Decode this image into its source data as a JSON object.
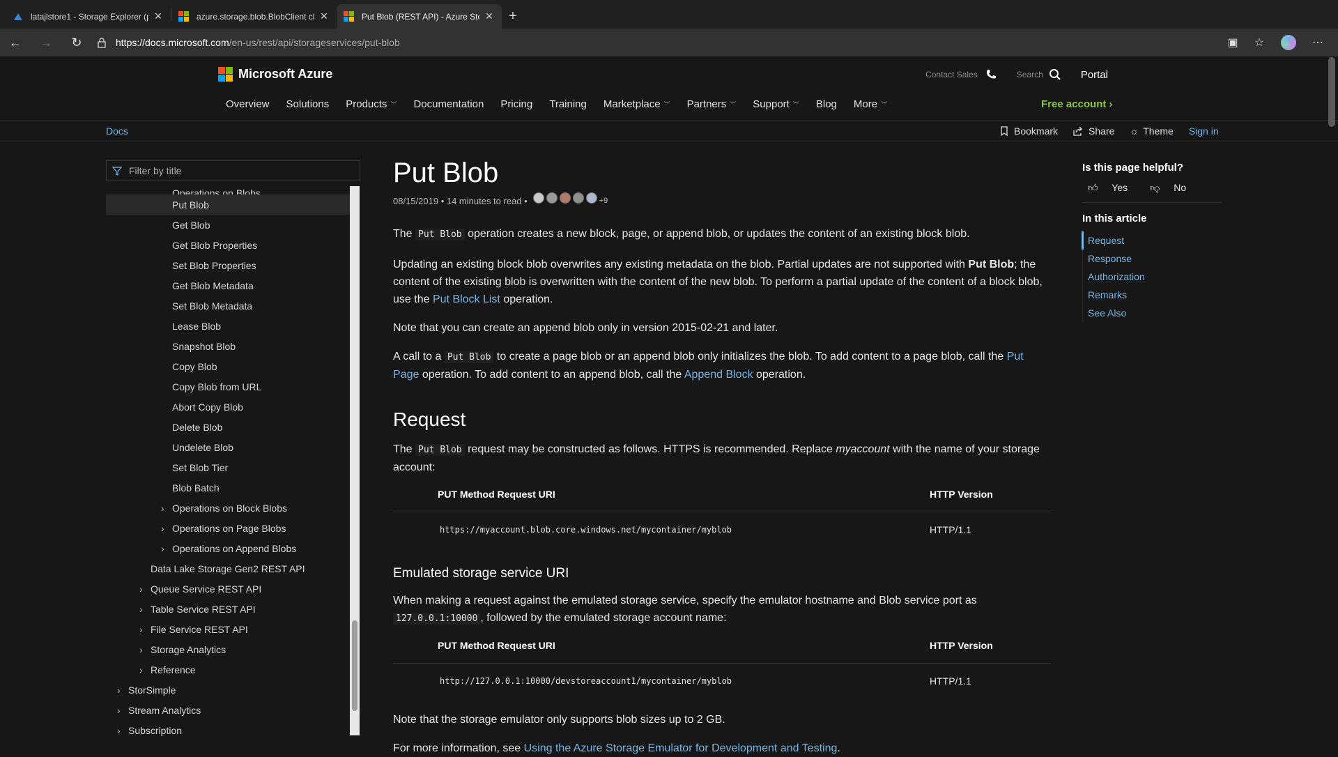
{
  "browser": {
    "tabs": [
      {
        "title": "latajlstore1 - Storage Explorer (p",
        "active": false
      },
      {
        "title": "azure.storage.blob.BlobClient cl",
        "active": false
      },
      {
        "title": "Put Blob (REST API) - Azure Sto",
        "active": true
      }
    ],
    "new_tab": "+",
    "url_host": "https://docs.microsoft.com",
    "url_path": "/en-us/rest/api/storageservices/put-blob"
  },
  "header": {
    "brand": "Microsoft Azure",
    "contact_sales": "Contact Sales",
    "search": "Search",
    "portal": "Portal",
    "nav": [
      {
        "label": "Overview",
        "dropdown": false
      },
      {
        "label": "Solutions",
        "dropdown": false
      },
      {
        "label": "Products",
        "dropdown": true
      },
      {
        "label": "Documentation",
        "dropdown": false
      },
      {
        "label": "Pricing",
        "dropdown": false
      },
      {
        "label": "Training",
        "dropdown": false
      },
      {
        "label": "Marketplace",
        "dropdown": true
      },
      {
        "label": "Partners",
        "dropdown": true
      },
      {
        "label": "Support",
        "dropdown": true
      },
      {
        "label": "Blog",
        "dropdown": false
      },
      {
        "label": "More",
        "dropdown": true
      }
    ],
    "free_account": "Free account"
  },
  "docsbar": {
    "docs": "Docs",
    "bookmark": "Bookmark",
    "share": "Share",
    "theme": "Theme",
    "signin": "Sign in"
  },
  "sidebar": {
    "filter_placeholder": "Filter by title",
    "items": [
      {
        "label": "Operations on Blobs",
        "indent": 2,
        "caret": false,
        "selected": false
      },
      {
        "label": "Put Blob",
        "indent": 2,
        "caret": false,
        "selected": true
      },
      {
        "label": "Get Blob",
        "indent": 2,
        "caret": false,
        "selected": false
      },
      {
        "label": "Get Blob Properties",
        "indent": 2,
        "caret": false,
        "selected": false
      },
      {
        "label": "Set Blob Properties",
        "indent": 2,
        "caret": false,
        "selected": false
      },
      {
        "label": "Get Blob Metadata",
        "indent": 2,
        "caret": false,
        "selected": false
      },
      {
        "label": "Set Blob Metadata",
        "indent": 2,
        "caret": false,
        "selected": false
      },
      {
        "label": "Lease Blob",
        "indent": 2,
        "caret": false,
        "selected": false
      },
      {
        "label": "Snapshot Blob",
        "indent": 2,
        "caret": false,
        "selected": false
      },
      {
        "label": "Copy Blob",
        "indent": 2,
        "caret": false,
        "selected": false
      },
      {
        "label": "Copy Blob from URL",
        "indent": 2,
        "caret": false,
        "selected": false
      },
      {
        "label": "Abort Copy Blob",
        "indent": 2,
        "caret": false,
        "selected": false
      },
      {
        "label": "Delete Blob",
        "indent": 2,
        "caret": false,
        "selected": false
      },
      {
        "label": "Undelete Blob",
        "indent": 2,
        "caret": false,
        "selected": false
      },
      {
        "label": "Set Blob Tier",
        "indent": 2,
        "caret": false,
        "selected": false
      },
      {
        "label": "Blob Batch",
        "indent": 2,
        "caret": false,
        "selected": false
      },
      {
        "label": "Operations on Block Blobs",
        "indent": 2,
        "caret": true,
        "selected": false
      },
      {
        "label": "Operations on Page Blobs",
        "indent": 2,
        "caret": true,
        "selected": false
      },
      {
        "label": "Operations on Append Blobs",
        "indent": 2,
        "caret": true,
        "selected": false
      },
      {
        "label": "Data Lake Storage Gen2 REST API",
        "indent": 1,
        "caret": false,
        "selected": false
      },
      {
        "label": "Queue Service REST API",
        "indent": 1,
        "caret": true,
        "selected": false
      },
      {
        "label": "Table Service REST API",
        "indent": 1,
        "caret": true,
        "selected": false
      },
      {
        "label": "File Service REST API",
        "indent": 1,
        "caret": true,
        "selected": false
      },
      {
        "label": "Storage Analytics",
        "indent": 1,
        "caret": true,
        "selected": false
      },
      {
        "label": "Reference",
        "indent": 1,
        "caret": true,
        "selected": false
      },
      {
        "label": "StorSimple",
        "indent": 0,
        "caret": true,
        "selected": false
      },
      {
        "label": "Stream Analytics",
        "indent": 0,
        "caret": true,
        "selected": false
      },
      {
        "label": "Subscription",
        "indent": 0,
        "caret": true,
        "selected": false
      }
    ]
  },
  "article": {
    "title": "Put Blob",
    "date": "08/15/2019",
    "read_time": "14 minutes to read",
    "contributors_more": "+9",
    "p1_a": "The ",
    "p1_code": "Put Blob",
    "p1_b": " operation creates a new block, page, or append blob, or updates the content of an existing block blob.",
    "p2_a": "Updating an existing block blob overwrites any existing metadata on the blob. Partial updates are not supported with ",
    "p2_bold": "Put Blob",
    "p2_b": "; the content of the existing blob is overwritten with the content of the new blob. To perform a partial update of the content of a block blob, use the ",
    "p2_link": "Put Block List",
    "p2_c": " operation.",
    "p3": "Note that you can create an append blob only in version 2015-02-21 and later.",
    "p4_a": "A call to a ",
    "p4_code": "Put Blob",
    "p4_b": " to create a page blob or an append blob only initializes the blob. To add content to a page blob, call the ",
    "p4_link1": "Put Page",
    "p4_c": " operation. To add content to an append blob, call the ",
    "p4_link2": "Append Block",
    "p4_d": " operation.",
    "request_heading": "Request",
    "req_a": "The ",
    "req_code": "Put Blob",
    "req_b": " request may be constructed as follows. HTTPS is recommended. Replace ",
    "req_em": "myaccount",
    "req_c": " with the name of your storage account:",
    "table1": {
      "col_uri": "PUT Method Request URI",
      "col_ver": "HTTP Version",
      "uri": "https://myaccount.blob.core.windows.net/mycontainer/myblob",
      "ver": "HTTP/1.1"
    },
    "emulated_heading": "Emulated storage service URI",
    "emu_a": "When making a request against the emulated storage service, specify the emulator hostname and Blob service port as ",
    "emu_code": "127.0.0.1:10000",
    "emu_b": ", followed by the emulated storage account name:",
    "table2": {
      "col_uri": "PUT Method Request URI",
      "col_ver": "HTTP Version",
      "uri": "http://127.0.0.1:10000/devstoreaccount1/mycontainer/myblob",
      "ver": "HTTP/1.1"
    },
    "p5": "Note that the storage emulator only supports blob sizes up to 2 GB.",
    "p6_a": "For more information, see ",
    "p6_link": "Using the Azure Storage Emulator for Development and Testing",
    "p6_b": "."
  },
  "rail": {
    "helpful": "Is this page helpful?",
    "yes": "Yes",
    "no": "No",
    "in_this_article": "In this article",
    "toc": [
      "Request",
      "Response",
      "Authorization",
      "Remarks",
      "See Also"
    ]
  },
  "colors": {
    "accent_link": "#75b6e7",
    "free_account": "#8dc63f",
    "background": "#171717"
  }
}
